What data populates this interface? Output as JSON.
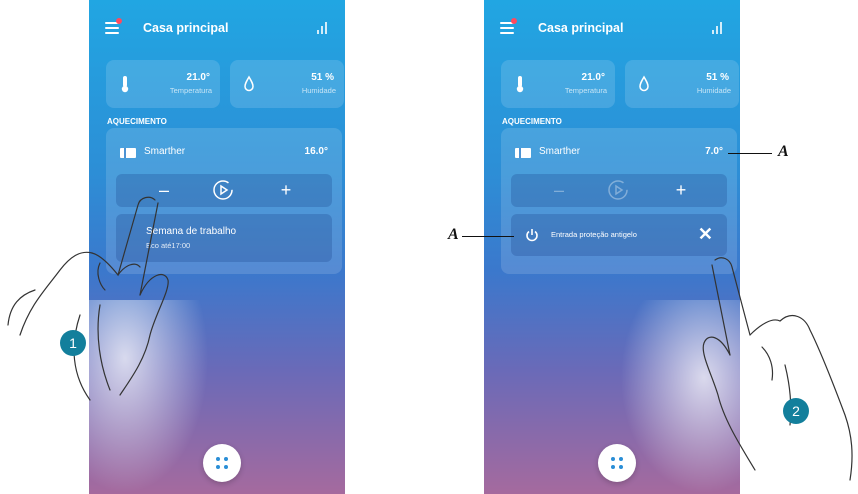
{
  "app": {
    "title": "Casa principal",
    "temperature": {
      "value": "21.0°",
      "label": "Temperatura"
    },
    "humidity": {
      "value": "51 %",
      "label": "Humidade"
    },
    "section_title": "AQUECIMENTO"
  },
  "panel1": {
    "device_name": "Smarther",
    "device_temp": "16.0°",
    "minus": "–",
    "plus": "+",
    "program_name": "Semana de trabalho",
    "program_detail": "Eco até17:00"
  },
  "panel2": {
    "device_name": "Smarther",
    "device_temp": "7.0°",
    "minus": "–",
    "plus": "+",
    "antifreeze_text": "Entrada proteção antigelo",
    "close": "✕"
  },
  "annotations": {
    "step1": "1",
    "step2": "2",
    "callout_a_top": "A",
    "callout_a_left": "A"
  },
  "colors": {
    "accent": "#2a8ed6",
    "badge": "#137f9c",
    "notification": "#ff4a5e"
  }
}
